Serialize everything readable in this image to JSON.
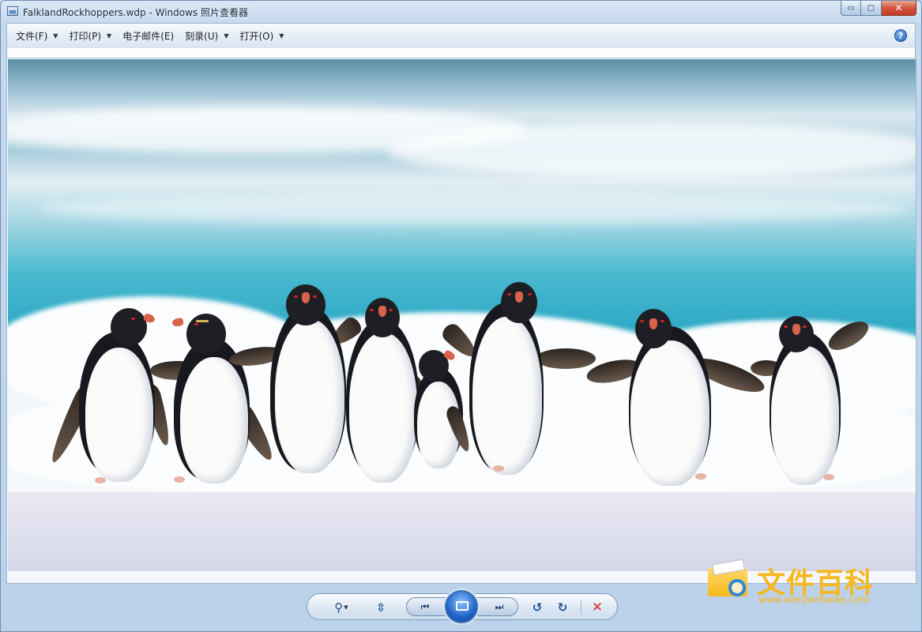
{
  "window": {
    "title": "FalklandRockhoppers.wdp - Windows 照片查看器",
    "caption_buttons": {
      "minimize": "▭",
      "maximize": "▢",
      "close": "✕"
    }
  },
  "menu": {
    "items": [
      {
        "label": "文件(F)",
        "has_dropdown": true
      },
      {
        "label": "打印(P)",
        "has_dropdown": true
      },
      {
        "label": "电子邮件(E)",
        "has_dropdown": false
      },
      {
        "label": "刻录(U)",
        "has_dropdown": true
      },
      {
        "label": "打开(O)",
        "has_dropdown": true
      }
    ],
    "dropdown_glyph": "▼",
    "help_glyph": "?"
  },
  "photo": {
    "subject": "rockhopper-penguins-on-beach",
    "colors": {
      "sea": "#30aac6",
      "foam": "#f6f9fb",
      "sand": "#d7d9ea"
    }
  },
  "toolbar": {
    "zoom_icon": "magnifier-plus-icon",
    "fit_icon": "actual-size-icon",
    "prev_icon": "previous-icon",
    "slideshow_icon": "slideshow-icon",
    "next_icon": "next-icon",
    "rotate_ccw_icon": "rotate-counterclockwise-icon",
    "rotate_cw_icon": "rotate-clockwise-icon",
    "delete_icon": "delete-icon",
    "glyphs": {
      "zoom": "⚲",
      "fit": "⇳",
      "prev": "⏮",
      "next": "⏭",
      "rotate_ccw": "↺",
      "rotate_cw": "↻",
      "delete": "✕",
      "dropdown": "▼"
    }
  },
  "watermark": {
    "title": "文件百科",
    "url": "www.wenjianbaike.com",
    "color": "#f6b81e"
  }
}
